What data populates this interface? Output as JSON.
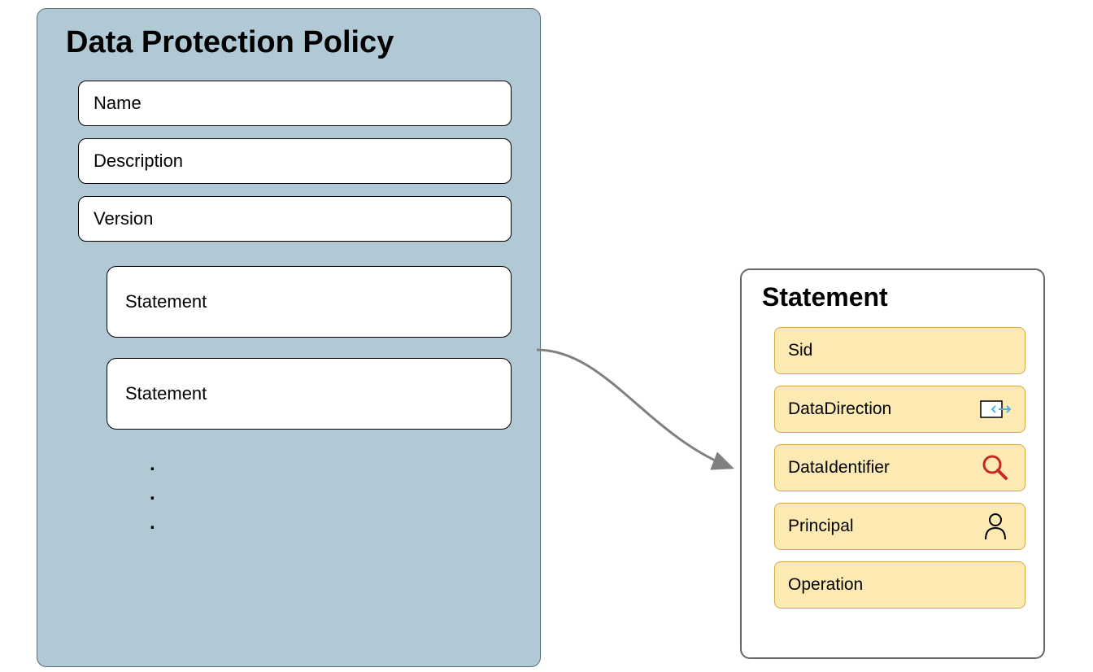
{
  "policy": {
    "title": "Data Protection Policy",
    "fields": [
      "Name",
      "Description",
      "Version"
    ],
    "statements": [
      "Statement",
      "Statement"
    ]
  },
  "statement": {
    "title": "Statement",
    "fields": [
      {
        "label": "Sid",
        "icon": null
      },
      {
        "label": "DataDirection",
        "icon": "data-direction"
      },
      {
        "label": "DataIdentifier",
        "icon": "magnifier"
      },
      {
        "label": "Principal",
        "icon": "person"
      },
      {
        "label": "Operation",
        "icon": null
      }
    ]
  }
}
